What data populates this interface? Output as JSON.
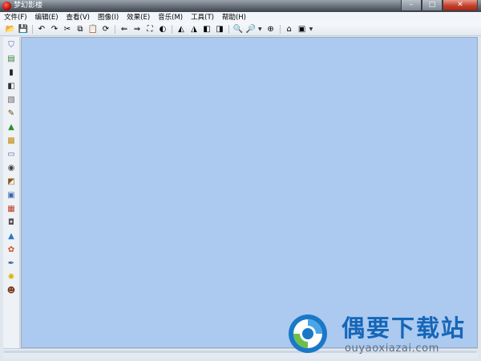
{
  "window": {
    "title": "梦幻影楼",
    "controls": {
      "minimize": "–",
      "maximize": "□",
      "close": "✕"
    }
  },
  "menu": [
    {
      "label": "文件(F)"
    },
    {
      "label": "编辑(E)"
    },
    {
      "label": "查看(V)"
    },
    {
      "label": "图像(I)"
    },
    {
      "label": "效果(E)"
    },
    {
      "label": "音乐(M)"
    },
    {
      "label": "工具(T)"
    },
    {
      "label": "帮助(H)"
    }
  ],
  "toolbar": [
    {
      "icon": "open-folder-icon",
      "glyph": "📂"
    },
    {
      "icon": "save-icon",
      "glyph": "💾"
    },
    {
      "sep": true
    },
    {
      "icon": "undo-icon",
      "glyph": "↶"
    },
    {
      "icon": "redo-icon",
      "glyph": "↷"
    },
    {
      "icon": "cut-icon",
      "glyph": "✂"
    },
    {
      "icon": "copy-icon",
      "glyph": "⧉"
    },
    {
      "icon": "paste-icon",
      "glyph": "📋"
    },
    {
      "icon": "refresh-icon",
      "glyph": "⟳"
    },
    {
      "sep": true
    },
    {
      "icon": "arrow-left-icon",
      "glyph": "⇐"
    },
    {
      "icon": "arrow-right-icon",
      "glyph": "⇒"
    },
    {
      "icon": "crop-icon",
      "glyph": "⛶"
    },
    {
      "icon": "rotate-icon",
      "glyph": "◐"
    },
    {
      "sep": true
    },
    {
      "icon": "flip-left-icon",
      "glyph": "◭"
    },
    {
      "icon": "flip-right-icon",
      "glyph": "◮"
    },
    {
      "icon": "mirror-horizontal-icon",
      "glyph": "◧"
    },
    {
      "icon": "mirror-vertical-icon",
      "glyph": "◨"
    },
    {
      "sep": true
    },
    {
      "icon": "zoom-in-icon",
      "glyph": "🔍"
    },
    {
      "icon": "zoom-out-icon",
      "glyph": "🔎",
      "dropdown": true
    },
    {
      "icon": "zoom-fit-icon",
      "glyph": "⊕"
    },
    {
      "sep": true
    },
    {
      "icon": "home-icon",
      "glyph": "⌂"
    },
    {
      "icon": "image-icon",
      "glyph": "▣",
      "dropdown": true
    }
  ],
  "toolbox": [
    {
      "icon": "bookmark-icon",
      "glyph": "⛉",
      "color": "#3a5fb0"
    },
    {
      "icon": "document-icon",
      "glyph": "▤",
      "color": "#3b7d3b"
    },
    {
      "icon": "film-icon",
      "glyph": "▮",
      "color": "#222222"
    },
    {
      "icon": "contrast-icon",
      "glyph": "◧",
      "color": "#333333"
    },
    {
      "icon": "grayscale-icon",
      "glyph": "▧",
      "color": "#666666"
    },
    {
      "icon": "pencil-icon",
      "glyph": "✎",
      "color": "#6a4a12"
    },
    {
      "icon": "landscape-icon",
      "glyph": "▲",
      "color": "#2f8b2f"
    },
    {
      "icon": "picture-icon",
      "glyph": "▩",
      "color": "#c28a14"
    },
    {
      "icon": "frame-icon",
      "glyph": "▭",
      "color": "#4a6fa8"
    },
    {
      "icon": "camera-icon",
      "glyph": "◉",
      "color": "#444444"
    },
    {
      "icon": "palette-icon",
      "glyph": "◩",
      "color": "#8a5a10"
    },
    {
      "icon": "window-icon",
      "glyph": "▣",
      "color": "#3a6ab0"
    },
    {
      "icon": "gradient-icon",
      "glyph": "▦",
      "color": "#c03a2a"
    },
    {
      "icon": "photo-frame-icon",
      "glyph": "◘",
      "color": "#555555"
    },
    {
      "icon": "triangle-icon",
      "glyph": "▲",
      "color": "#2a7ac0"
    },
    {
      "icon": "butterfly-icon",
      "glyph": "✿",
      "color": "#d05020"
    },
    {
      "icon": "brush-icon",
      "glyph": "✒",
      "color": "#2a5a9a"
    },
    {
      "icon": "lightbulb-icon",
      "glyph": "✺",
      "color": "#d8b200"
    },
    {
      "icon": "face-icon",
      "glyph": "☻",
      "color": "#7a3a1a"
    }
  ],
  "watermark": {
    "title": "偶要下载站",
    "domain": "ouyaoxiazai.com"
  },
  "colors": {
    "canvas": "#acc9f0",
    "brand_blue": "#1566b8"
  }
}
